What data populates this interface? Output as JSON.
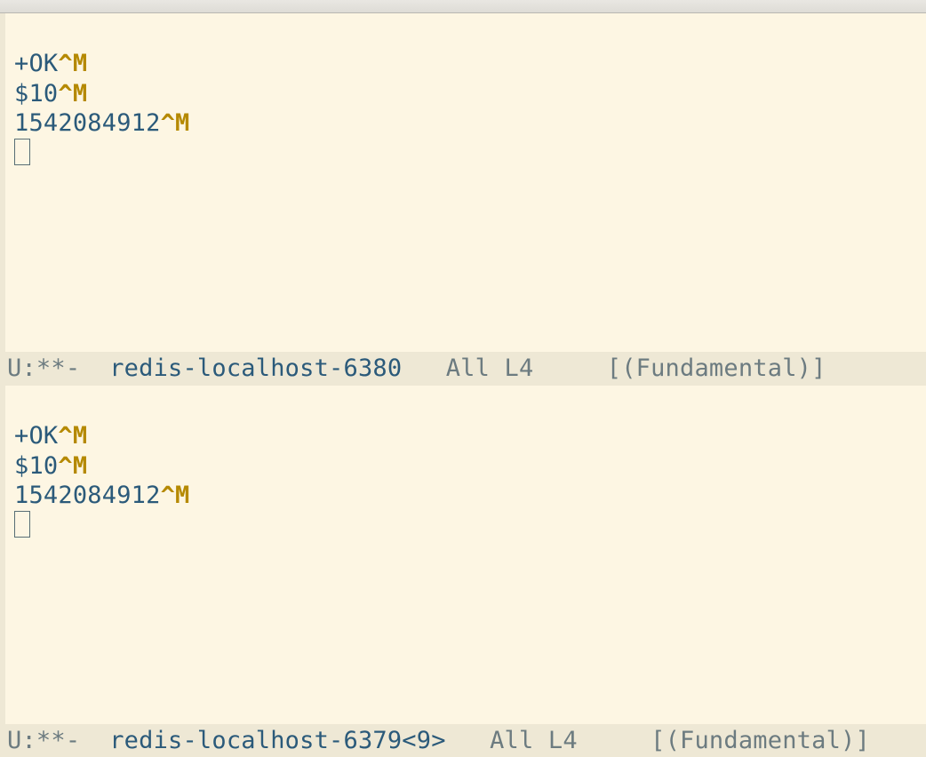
{
  "panes": [
    {
      "lines": [
        {
          "segments": [
            {
              "text": "+OK",
              "cls": "token"
            },
            {
              "text": "^M",
              "cls": "ctrl"
            }
          ]
        },
        {
          "segments": [
            {
              "text": "$10",
              "cls": "token"
            },
            {
              "text": "^M",
              "cls": "ctrl"
            }
          ]
        },
        {
          "segments": [
            {
              "text": "1542084912",
              "cls": "token"
            },
            {
              "text": "^M",
              "cls": "ctrl"
            }
          ]
        }
      ],
      "cursor_on_new_line": true,
      "modeline": {
        "status": "U:**-",
        "buffer_name": "redis-localhost-6380",
        "position": "All",
        "line": "L4",
        "mode": "(Fundamental)"
      }
    },
    {
      "lines": [
        {
          "segments": [
            {
              "text": "+OK",
              "cls": "token"
            },
            {
              "text": "^M",
              "cls": "ctrl"
            }
          ]
        },
        {
          "segments": [
            {
              "text": "$10",
              "cls": "token"
            },
            {
              "text": "^M",
              "cls": "ctrl"
            }
          ]
        },
        {
          "segments": [
            {
              "text": "1542084912",
              "cls": "token"
            },
            {
              "text": "^M",
              "cls": "ctrl"
            }
          ]
        }
      ],
      "cursor_on_new_line": true,
      "modeline": {
        "status": "U:**-",
        "buffer_name": "redis-localhost-6379<9>",
        "position": "All",
        "line": "L4",
        "mode": "(Fundamental)"
      }
    }
  ]
}
